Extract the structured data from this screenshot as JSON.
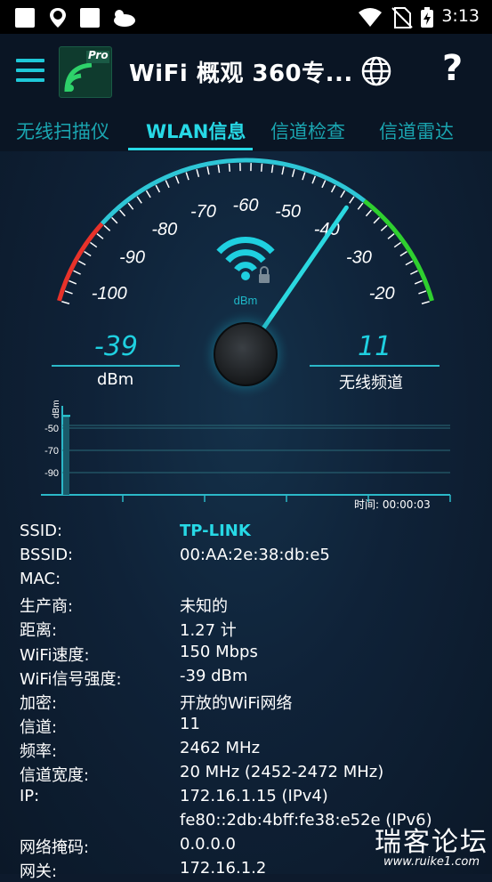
{
  "status_bar": {
    "time": "3:13"
  },
  "app_bar": {
    "title": "WiFi 概观 360专...",
    "logo_badge": "Pro"
  },
  "tabs": [
    {
      "label": "无线扫描仪"
    },
    {
      "label": "WLAN信息"
    },
    {
      "label": "信道检查"
    },
    {
      "label": "信道雷达"
    }
  ],
  "gauge": {
    "unit": "dBm",
    "scale_labels": [
      "-100",
      "-90",
      "-80",
      "-70",
      "-60",
      "-50",
      "-40",
      "-30",
      "-20"
    ],
    "signal_value": "-39",
    "signal_unit": "dBm",
    "channel_value": "11",
    "channel_label": "无线频道",
    "needle_value": -39,
    "colors": {
      "low": "#e8322a",
      "mid": "#2ec6d6",
      "high": "#2fd02f"
    }
  },
  "graph": {
    "unit": "dBm",
    "y_labels": [
      "-50",
      "-70",
      "-90"
    ],
    "time_label": "时间:  00:00:03",
    "current_level": -39
  },
  "info": {
    "rows": [
      {
        "key": "SSID:",
        "value": "TP-LINK"
      },
      {
        "key": "BSSID:",
        "value": "00:AA:2e:38:db:e5"
      },
      {
        "key": "MAC:",
        "value": ""
      },
      {
        "key": "生产商:",
        "value": "未知的"
      },
      {
        "key": "距离:",
        "value": "1.27 计"
      },
      {
        "key": "WiFi速度:",
        "value": "150 Mbps"
      },
      {
        "key": "WiFi信号强度:",
        "value": "-39 dBm"
      },
      {
        "key": "加密:",
        "value": "开放的WiFi网络"
      },
      {
        "key": "信道:",
        "value": "11"
      },
      {
        "key": "频率:",
        "value": "2462 MHz"
      },
      {
        "key": "信道宽度:",
        "value": "20 MHz (2452-2472 MHz)"
      },
      {
        "key": "IP:",
        "value": "172.16.1.15 (IPv4)"
      },
      {
        "key": "",
        "value": "fe80::2db:4bff:fe38:e52e (IPv6)"
      },
      {
        "key": "网络掩码:",
        "value": "0.0.0.0"
      },
      {
        "key": "网关:",
        "value": "172.16.1.2"
      }
    ]
  },
  "watermark": {
    "title": "瑞客论坛",
    "url": "www.ruike1.com"
  }
}
